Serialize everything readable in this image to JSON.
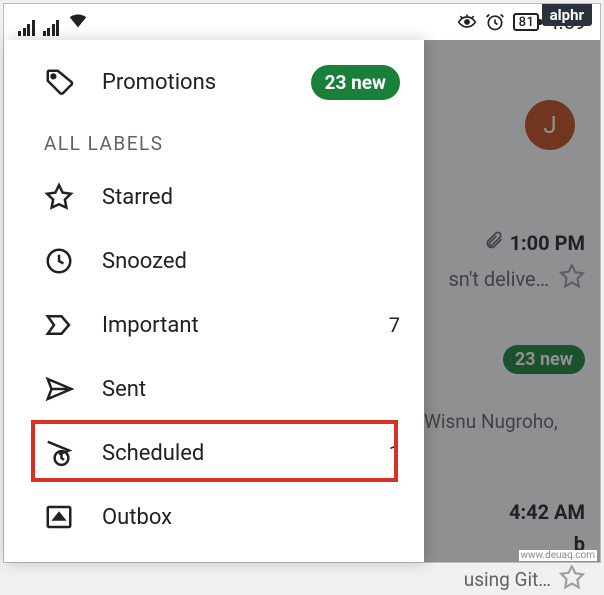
{
  "status_bar": {
    "battery_pct": "81",
    "clock": "4:59"
  },
  "drawer": {
    "promotions": {
      "label": "Promotions",
      "badge": "23 new"
    },
    "section_title": "ALL LABELS",
    "items": {
      "starred": {
        "label": "Starred"
      },
      "snoozed": {
        "label": "Snoozed"
      },
      "important": {
        "label": "Important",
        "count": "7"
      },
      "sent": {
        "label": "Sent"
      },
      "scheduled": {
        "label": "Scheduled",
        "count": "1"
      },
      "outbox": {
        "label": "Outbox"
      }
    }
  },
  "background": {
    "avatar_letter": "J",
    "row1": {
      "time": "1:00 PM",
      "snippet": "sn't delive…"
    },
    "row2": {
      "badge": "23 new"
    },
    "row3": {
      "snippet": "Wisnu Nugroho,"
    },
    "row4": {
      "time": "4:42 AM",
      "title_suffix": "b",
      "line": "using Git…"
    }
  },
  "brand": {
    "badge": "alphr",
    "watermark": "www.deuaq.com"
  }
}
